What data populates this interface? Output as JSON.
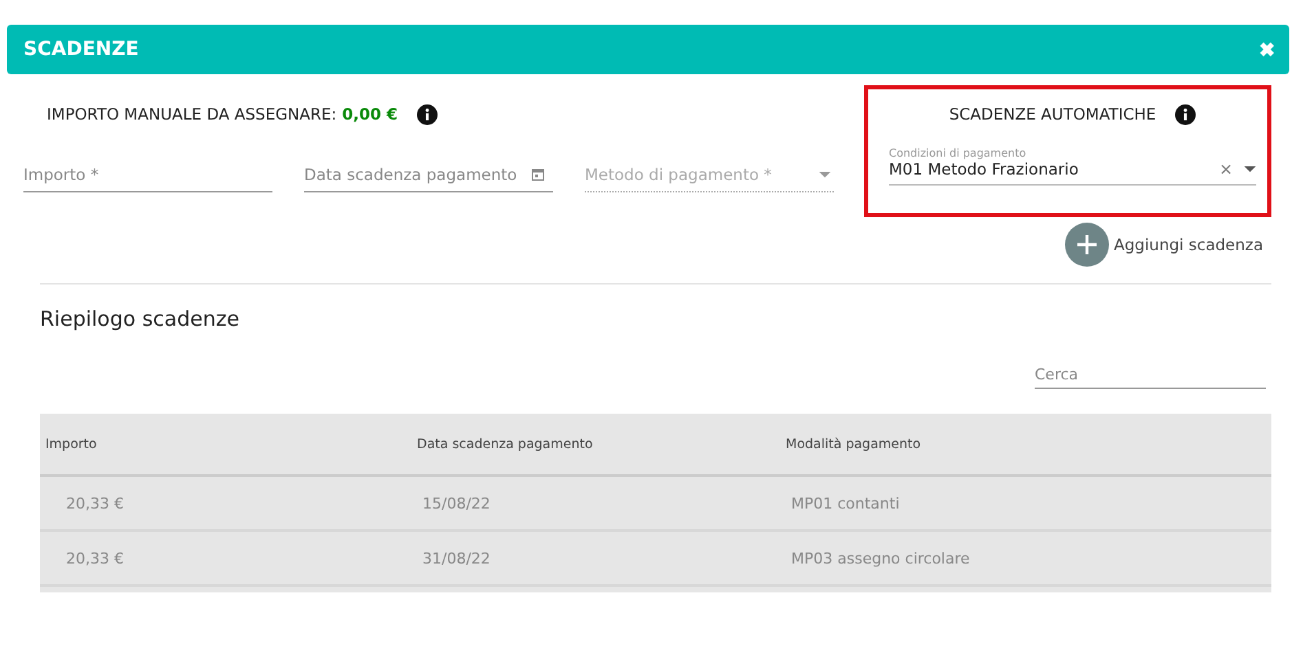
{
  "window": {
    "title": "SCADENZE",
    "close": "✖"
  },
  "manual": {
    "label": "IMPORTO MANUALE DA ASSEGNARE:",
    "amount": "0,00 €"
  },
  "fields": [
    {
      "kind": "input",
      "placeholder": "Importo *",
      "disabled": false
    },
    {
      "kind": "date",
      "placeholder": "Data scadenza pagamento",
      "disabled": false
    },
    {
      "kind": "select",
      "placeholder": "Metodo di pagamento *",
      "disabled": true
    }
  ],
  "automatic": {
    "title": "SCADENZE AUTOMATICHE",
    "highlighted": true,
    "field": {
      "label": "Condizioni di pagamento",
      "value": "M01 Metodo Frazionario",
      "clear": "×"
    }
  },
  "add_button": {
    "label": "Aggiungi scadenza"
  },
  "summary": {
    "title": "Riepilogo scadenze",
    "search": {
      "placeholder": "Cerca"
    },
    "table": {
      "columns": [
        "Importo",
        "Data scadenza pagamento",
        "Modalità pagamento"
      ],
      "rows": [
        [
          "20,33 €",
          "15/08/22",
          "MP01 contanti"
        ],
        [
          "20,33 €",
          "31/08/22",
          "MP03 assegno circolare"
        ]
      ]
    }
  }
}
